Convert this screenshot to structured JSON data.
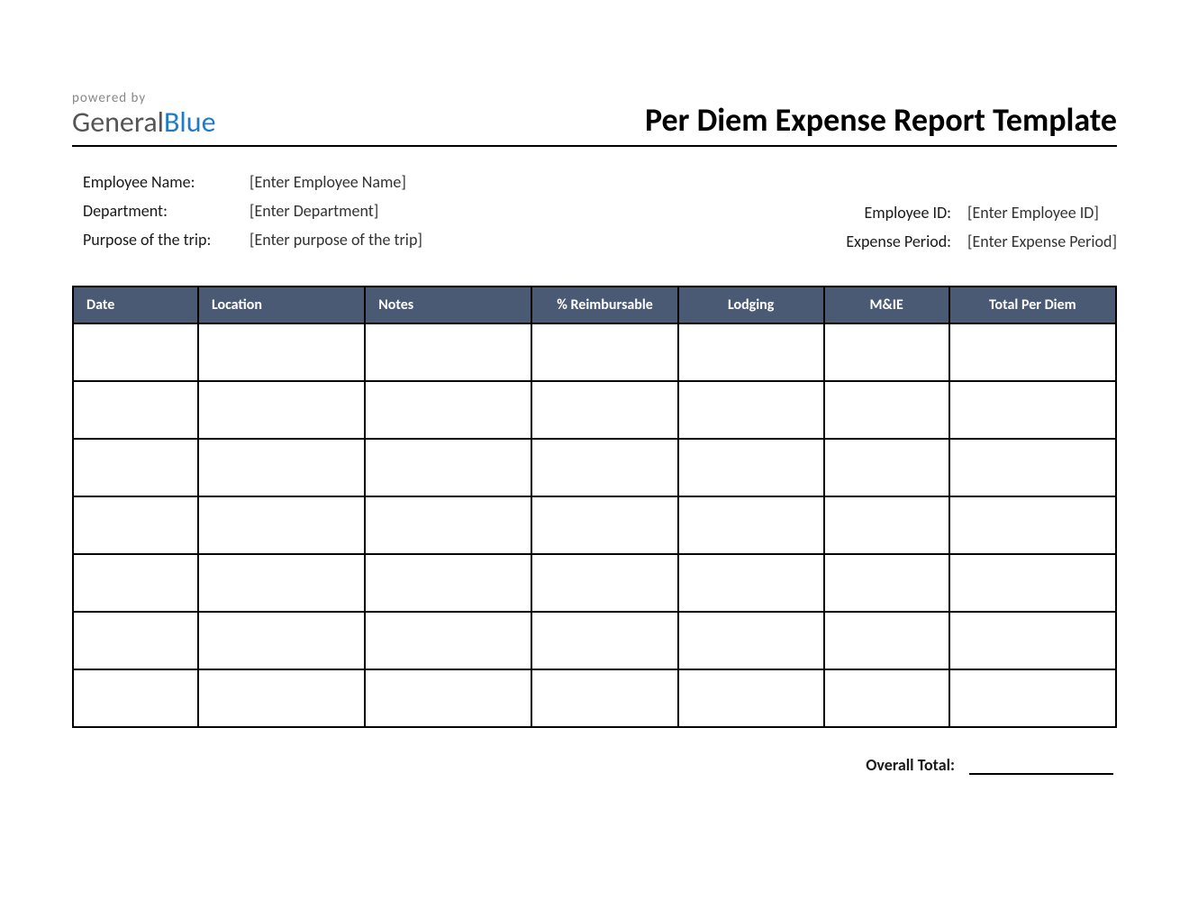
{
  "branding": {
    "powered_by": "powered by",
    "logo_part1": "General",
    "logo_part2": "Blue"
  },
  "title": "Per Diem Expense Report Template",
  "info": {
    "employee_name_label": "Employee Name:",
    "employee_name_value": "[Enter Employee Name]",
    "department_label": "Department:",
    "department_value": "[Enter Department]",
    "purpose_label": "Purpose of the trip:",
    "purpose_value": "[Enter purpose of the trip]",
    "employee_id_label": "Employee ID:",
    "employee_id_value": "[Enter Employee ID]",
    "expense_period_label": "Expense Period:",
    "expense_period_value": "[Enter Expense Period]"
  },
  "columns": {
    "date": "Date",
    "location": "Location",
    "notes": "Notes",
    "reimbursable": "% Reimbursable",
    "lodging": "Lodging",
    "mie": "M&IE",
    "total": "Total Per Diem"
  },
  "rows": [
    {
      "date": "",
      "location": "",
      "notes": "",
      "reimbursable": "",
      "lodging": "",
      "mie": "",
      "total": ""
    },
    {
      "date": "",
      "location": "",
      "notes": "",
      "reimbursable": "",
      "lodging": "",
      "mie": "",
      "total": ""
    },
    {
      "date": "",
      "location": "",
      "notes": "",
      "reimbursable": "",
      "lodging": "",
      "mie": "",
      "total": ""
    },
    {
      "date": "",
      "location": "",
      "notes": "",
      "reimbursable": "",
      "lodging": "",
      "mie": "",
      "total": ""
    },
    {
      "date": "",
      "location": "",
      "notes": "",
      "reimbursable": "",
      "lodging": "",
      "mie": "",
      "total": ""
    },
    {
      "date": "",
      "location": "",
      "notes": "",
      "reimbursable": "",
      "lodging": "",
      "mie": "",
      "total": ""
    },
    {
      "date": "",
      "location": "",
      "notes": "",
      "reimbursable": "",
      "lodging": "",
      "mie": "",
      "total": ""
    }
  ],
  "footer": {
    "overall_total_label": "Overall Total:",
    "overall_total_value": ""
  }
}
